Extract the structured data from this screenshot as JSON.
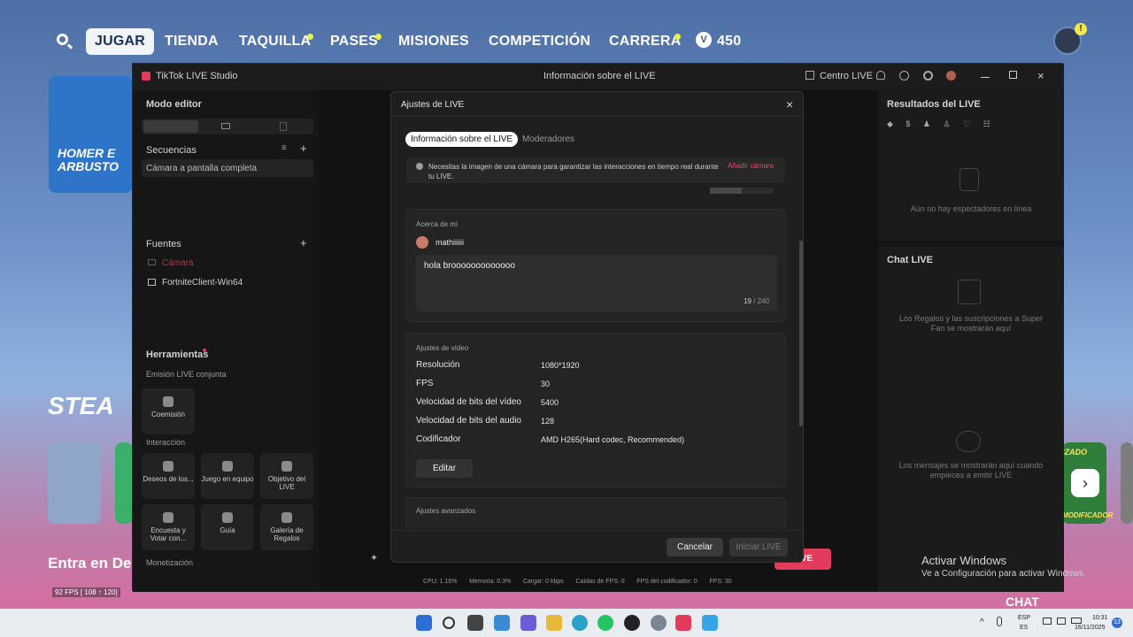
{
  "game": {
    "nav": [
      "JUGAR",
      "TIENDA",
      "TAQUILLA",
      "PASES",
      "MISIONES",
      "COMPETICIÓN",
      "CARRERA"
    ],
    "vbucks": "450",
    "homer": "HOMER E ARBUSTO",
    "steal": "STEA",
    "entra": "Entra en De",
    "fps": "92 FPS [ 108 ↑ 120]",
    "chat_label": "CHAT",
    "mod_label": "MODIFICADOR",
    "izado_label": "IZADO"
  },
  "studio": {
    "app_title": "TikTok LIVE Studio",
    "window_center": "Información sobre el LIVE",
    "centro_live": "Centro LIVE",
    "mode_editor": "Modo editor",
    "sequences": "Secuencias",
    "sequence_item": "Cámara a pantalla completa",
    "sources": "Fuentes",
    "source_camera": "Cámara",
    "source_fortnite": "FortniteClient-Win64",
    "tools": "Herramientas",
    "joint_live": "Emisión LIVE conjunta",
    "coemision": "Coemisión",
    "interaction": "Interacción",
    "interaction_items": [
      "Deseos de los...",
      "Juego en equipo",
      "Objetivo del LIVE",
      "Encuesta y Votar con...",
      "Guía",
      "Galería de Regalos"
    ],
    "monetization": "Monetización",
    "results_title": "Resultados del LIVE",
    "results_empty": "Aún no hay espectadores en línea",
    "chat_title": "Chat LIVE",
    "chat_gifts_msg": "Los Regalos y las suscripciones a Super Fan se mostrarán aquí",
    "chat_msgs": "Los mensajes se mostrarán aquí cuando empieces a emitir LIVE",
    "go_live": "LIVE",
    "status": {
      "cpu": "CPU: 1.16%",
      "memory": "Memoria: 0.3%",
      "load": "Cargar: 0 kbps",
      "drops": "Caídas de FPS: 0",
      "encoder_fps": "FPS del codificador: 0",
      "fps": "FPS: 30"
    }
  },
  "modal": {
    "title": "Ajustes de LIVE",
    "tabs": [
      "Información sobre el LIVE",
      "Moderadores"
    ],
    "notice": "Necesitas la imagen de una cámara para garantizar las interacciones en tiempo real durante tu LIVE.",
    "add_camera": "Añadir cámara",
    "about_title": "Acerca de mí",
    "username": "mathiiiiii",
    "bio": "hola brooooooooooooo",
    "bio_count": "19",
    "bio_max": "/ 240",
    "video_title": "Ajustes de vídeo",
    "video_rows": [
      {
        "label": "Resolución",
        "value": "1080*1920"
      },
      {
        "label": "FPS",
        "value": "30"
      },
      {
        "label": "Velocidad de bits del vídeo",
        "value": "5400"
      },
      {
        "label": "Velocidad de bits del audio",
        "value": "128"
      },
      {
        "label": "Codificador",
        "value": "AMD H265(Hard codec, Recommended)"
      }
    ],
    "edit": "Editar",
    "advanced": "Ajustes avanzados",
    "cancel": "Cancelar",
    "start": "Iniciar LIVE"
  },
  "windows": {
    "activate_title": "Activar Windows",
    "activate_sub": "Ve a Configuración para activar Windows.",
    "lang1": "ESP",
    "lang2": "ES",
    "time": "10:31",
    "date": "16/11/2025",
    "badge": "13"
  }
}
